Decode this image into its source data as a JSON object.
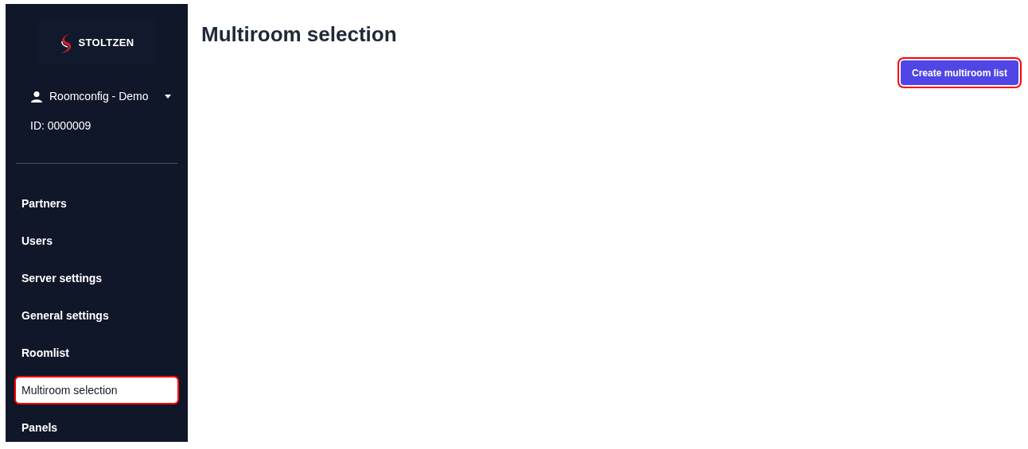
{
  "sidebar": {
    "logo": "STOLTZEN",
    "user": {
      "name": "Roomconfig - Demo",
      "id": "ID: 0000009"
    },
    "items": [
      {
        "label": "Partners",
        "selected": false,
        "annotated": false
      },
      {
        "label": "Users",
        "selected": false,
        "annotated": false
      },
      {
        "label": "Server settings",
        "selected": false,
        "annotated": false
      },
      {
        "label": "General settings",
        "selected": false,
        "annotated": false
      },
      {
        "label": "Roomlist",
        "selected": false,
        "annotated": false
      },
      {
        "label": "Multiroom selection",
        "selected": true,
        "annotated": true
      },
      {
        "label": "Panels",
        "selected": false,
        "annotated": false
      }
    ]
  },
  "main": {
    "title": "Multiroom selection",
    "create_button": {
      "label": "Create multiroom list",
      "annotated": true
    }
  }
}
